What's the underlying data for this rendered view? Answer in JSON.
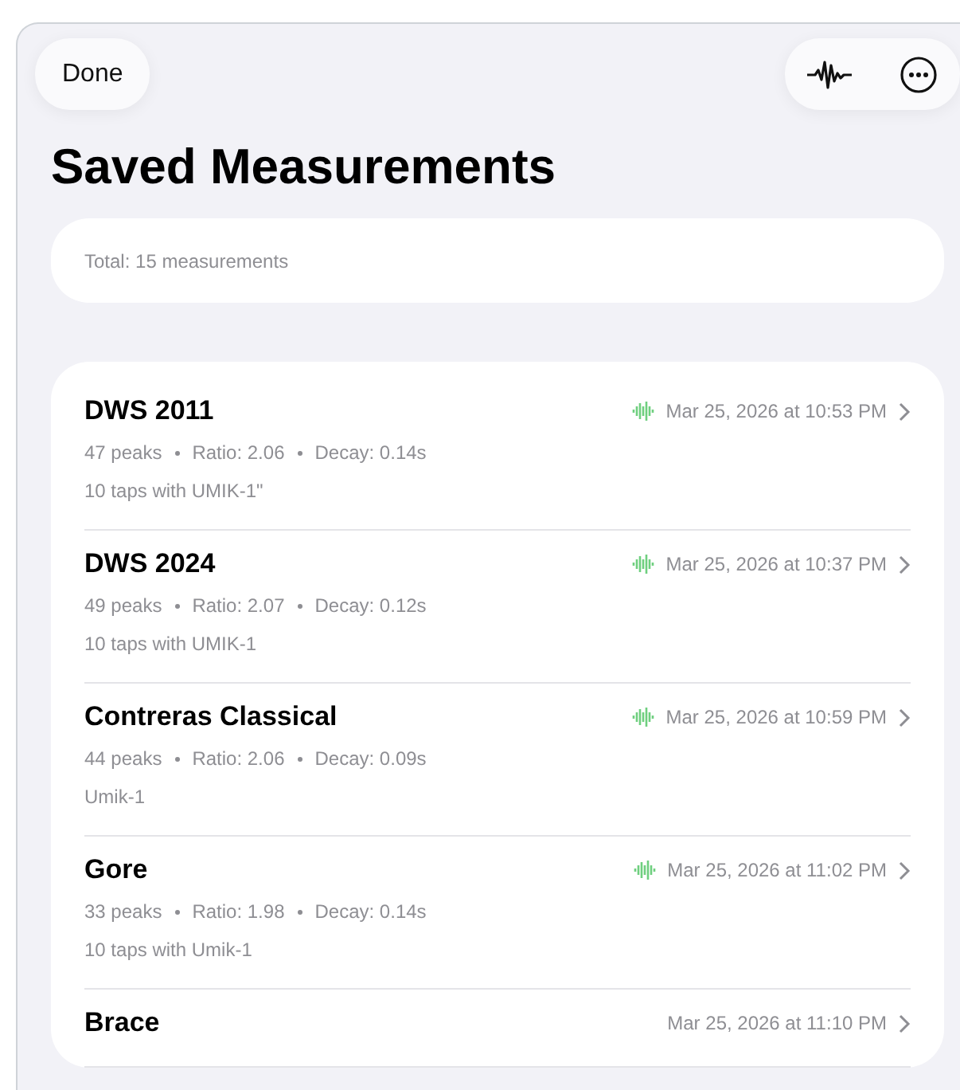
{
  "toolbar": {
    "done": "Done"
  },
  "title": "Saved Measurements",
  "summary": "Total: 15 measurements",
  "measurements": [
    {
      "name": "DWS 2011",
      "date": "Mar 25, 2026 at 10:53 PM",
      "has_audio": true,
      "peaks": "47 peaks",
      "ratio": "Ratio: 2.06",
      "decay": "Decay: 0.14s",
      "note": "10 taps with UMIK-1\""
    },
    {
      "name": "DWS 2024",
      "date": "Mar 25, 2026 at 10:37 PM",
      "has_audio": true,
      "peaks": "49 peaks",
      "ratio": "Ratio: 2.07",
      "decay": "Decay: 0.12s",
      "note": "10 taps with UMIK-1"
    },
    {
      "name": "Contreras Classical",
      "date": "Mar 25, 2026 at 10:59 PM",
      "has_audio": true,
      "peaks": "44 peaks",
      "ratio": "Ratio: 2.06",
      "decay": "Decay: 0.09s",
      "note": "Umik-1"
    },
    {
      "name": "Gore",
      "date": "Mar 25, 2026 at 11:02 PM",
      "has_audio": true,
      "peaks": "33 peaks",
      "ratio": "Ratio: 1.98",
      "decay": "Decay: 0.14s",
      "note": "10 taps with Umik-1"
    },
    {
      "name": "Brace",
      "date": "Mar 25, 2026 at 11:10 PM",
      "has_audio": false
    }
  ]
}
